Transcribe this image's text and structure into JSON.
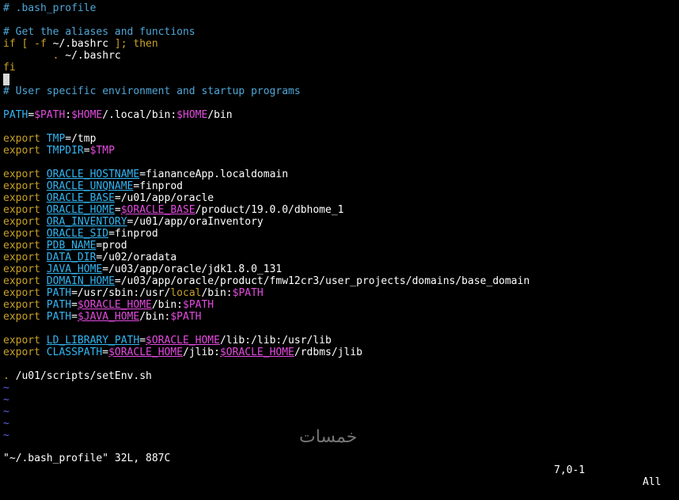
{
  "colors": {
    "background": "#000000",
    "comment": "#4fa7d8",
    "keyword": "#c9a227",
    "variable": "#33b6f2",
    "reference": "#e44be0",
    "text": "#ffffff",
    "tilde": "#5b63e6"
  },
  "editor": {
    "lines": [
      [
        {
          "t": "# .bash_profile",
          "c": "comment"
        }
      ],
      [],
      [
        {
          "t": "# Get the aliases and functions",
          "c": "comment"
        }
      ],
      [
        {
          "t": "if",
          "c": "keyword"
        },
        {
          "t": " [ ",
          "c": "keyword"
        },
        {
          "t": "-f",
          "c": "keyword"
        },
        {
          "t": " ~/.bashrc ",
          "c": "plain"
        },
        {
          "t": "];",
          "c": "keyword"
        },
        {
          "t": " then",
          "c": "keyword"
        }
      ],
      [
        {
          "t": "        . ",
          "c": "keyword"
        },
        {
          "t": "~/.bashrc",
          "c": "plain"
        }
      ],
      [
        {
          "t": "fi",
          "c": "keyword"
        }
      ],
      [
        {
          "t": " ",
          "c": "cursor"
        }
      ],
      [
        {
          "t": "# User specific environment and startup programs",
          "c": "comment"
        }
      ],
      [],
      [
        {
          "t": "PATH",
          "c": "var"
        },
        {
          "t": "=",
          "c": "plain"
        },
        {
          "t": "$PATH",
          "c": "ref"
        },
        {
          "t": ":",
          "c": "plain"
        },
        {
          "t": "$HOME",
          "c": "ref"
        },
        {
          "t": "/.local/bin:",
          "c": "plain"
        },
        {
          "t": "$HOME",
          "c": "ref"
        },
        {
          "t": "/bin",
          "c": "plain"
        }
      ],
      [],
      [
        {
          "t": "export",
          "c": "keyword"
        },
        {
          "t": " ",
          "c": "plain"
        },
        {
          "t": "TMP",
          "c": "var"
        },
        {
          "t": "=/tmp",
          "c": "plain"
        }
      ],
      [
        {
          "t": "export",
          "c": "keyword"
        },
        {
          "t": " ",
          "c": "plain"
        },
        {
          "t": "TMPDIR",
          "c": "var"
        },
        {
          "t": "=",
          "c": "plain"
        },
        {
          "t": "$TMP",
          "c": "ref"
        }
      ],
      [],
      [
        {
          "t": "export",
          "c": "keyword"
        },
        {
          "t": " ",
          "c": "plain"
        },
        {
          "t": "ORACLE_HOSTNAME",
          "c": "var",
          "u": true
        },
        {
          "t": "=fianance",
          "c": "plain"
        },
        {
          "t": "App.localdomain",
          "c": "plain"
        }
      ],
      [
        {
          "t": "export",
          "c": "keyword"
        },
        {
          "t": " ",
          "c": "plain"
        },
        {
          "t": "ORACLE_UNQNAME",
          "c": "var",
          "u": true
        },
        {
          "t": "=finprod",
          "c": "plain"
        }
      ],
      [
        {
          "t": "export",
          "c": "keyword"
        },
        {
          "t": " ",
          "c": "plain"
        },
        {
          "t": "ORACLE_BASE",
          "c": "var",
          "u": true
        },
        {
          "t": "=/u01/app/oracle",
          "c": "plain"
        }
      ],
      [
        {
          "t": "export",
          "c": "keyword"
        },
        {
          "t": " ",
          "c": "plain"
        },
        {
          "t": "ORACLE_HOME",
          "c": "var",
          "u": true
        },
        {
          "t": "=",
          "c": "plain"
        },
        {
          "t": "$ORACLE_BASE",
          "c": "ref",
          "u": true
        },
        {
          "t": "/product/19.0.0/dbhome_1",
          "c": "plain"
        }
      ],
      [
        {
          "t": "export",
          "c": "keyword"
        },
        {
          "t": " ",
          "c": "plain"
        },
        {
          "t": "ORA_INVENTORY",
          "c": "var",
          "u": true
        },
        {
          "t": "=/u01/app/oraInventory",
          "c": "plain"
        }
      ],
      [
        {
          "t": "export",
          "c": "keyword"
        },
        {
          "t": " ",
          "c": "plain"
        },
        {
          "t": "ORACLE_SID",
          "c": "var",
          "u": true
        },
        {
          "t": "=finprod",
          "c": "plain"
        }
      ],
      [
        {
          "t": "export",
          "c": "keyword"
        },
        {
          "t": " ",
          "c": "plain"
        },
        {
          "t": "PDB_NAME",
          "c": "var",
          "u": true
        },
        {
          "t": "=prod",
          "c": "plain"
        }
      ],
      [
        {
          "t": "export",
          "c": "keyword"
        },
        {
          "t": " ",
          "c": "plain"
        },
        {
          "t": "DATA_DIR",
          "c": "var",
          "u": true
        },
        {
          "t": "=/u02/oradata",
          "c": "plain"
        }
      ],
      [
        {
          "t": "export",
          "c": "keyword"
        },
        {
          "t": " ",
          "c": "plain"
        },
        {
          "t": "JAVA_HOME",
          "c": "var",
          "u": true
        },
        {
          "t": "=/u03/app/oracle/jdk1.8.0_131",
          "c": "plain"
        }
      ],
      [
        {
          "t": "export",
          "c": "keyword"
        },
        {
          "t": " ",
          "c": "plain"
        },
        {
          "t": "DOMAIN_HOME",
          "c": "var",
          "u": true
        },
        {
          "t": "=/u03/app/oracle/product/fmw12cr3/user_projects/domains/base_domain",
          "c": "plain"
        }
      ],
      [
        {
          "t": "export",
          "c": "keyword"
        },
        {
          "t": " ",
          "c": "plain"
        },
        {
          "t": "PATH",
          "c": "var"
        },
        {
          "t": "=/usr/sbin:/usr/",
          "c": "plain"
        },
        {
          "t": "local",
          "c": "keyword"
        },
        {
          "t": "/bin:",
          "c": "plain"
        },
        {
          "t": "$PATH",
          "c": "ref"
        }
      ],
      [
        {
          "t": "export",
          "c": "keyword"
        },
        {
          "t": " ",
          "c": "plain"
        },
        {
          "t": "PATH",
          "c": "var"
        },
        {
          "t": "=",
          "c": "plain"
        },
        {
          "t": "$ORACLE_HOME",
          "c": "ref",
          "u": true
        },
        {
          "t": "/bin:",
          "c": "plain"
        },
        {
          "t": "$PATH",
          "c": "ref"
        }
      ],
      [
        {
          "t": "export",
          "c": "keyword"
        },
        {
          "t": " ",
          "c": "plain"
        },
        {
          "t": "PATH",
          "c": "var"
        },
        {
          "t": "=",
          "c": "plain"
        },
        {
          "t": "$JAVA_HOME",
          "c": "ref",
          "u": true
        },
        {
          "t": "/bin:",
          "c": "plain"
        },
        {
          "t": "$PATH",
          "c": "ref"
        }
      ],
      [],
      [
        {
          "t": "export",
          "c": "keyword"
        },
        {
          "t": " ",
          "c": "plain"
        },
        {
          "t": "LD_LIBRARY_PATH",
          "c": "var",
          "u": true
        },
        {
          "t": "=",
          "c": "plain"
        },
        {
          "t": "$ORACLE_HOME",
          "c": "ref",
          "u": true
        },
        {
          "t": "/lib:/lib:/usr/lib",
          "c": "plain"
        }
      ],
      [
        {
          "t": "export",
          "c": "keyword"
        },
        {
          "t": " ",
          "c": "plain"
        },
        {
          "t": "CLASSPATH",
          "c": "var"
        },
        {
          "t": "=",
          "c": "plain"
        },
        {
          "t": "$ORACLE_HOME",
          "c": "ref",
          "u": true
        },
        {
          "t": "/jlib:",
          "c": "plain"
        },
        {
          "t": "$ORACLE_HOME",
          "c": "ref",
          "u": true
        },
        {
          "t": "/rdbms/jlib",
          "c": "plain"
        }
      ],
      [],
      [
        {
          "t": ".",
          "c": "keyword"
        },
        {
          "t": " /u01/scripts/setEnv.sh",
          "c": "plain"
        }
      ],
      [
        {
          "t": "~",
          "c": "tilde"
        }
      ],
      [
        {
          "t": "~",
          "c": "tilde"
        }
      ],
      [
        {
          "t": "~",
          "c": "tilde"
        }
      ],
      [
        {
          "t": "~",
          "c": "tilde"
        }
      ],
      [
        {
          "t": "~",
          "c": "tilde"
        }
      ]
    ]
  },
  "status": {
    "file": "\"~/.bash_profile\" 32L, 887C",
    "position": "7,0-1",
    "scroll": "All"
  },
  "watermark": {
    "text": "خمسات"
  }
}
